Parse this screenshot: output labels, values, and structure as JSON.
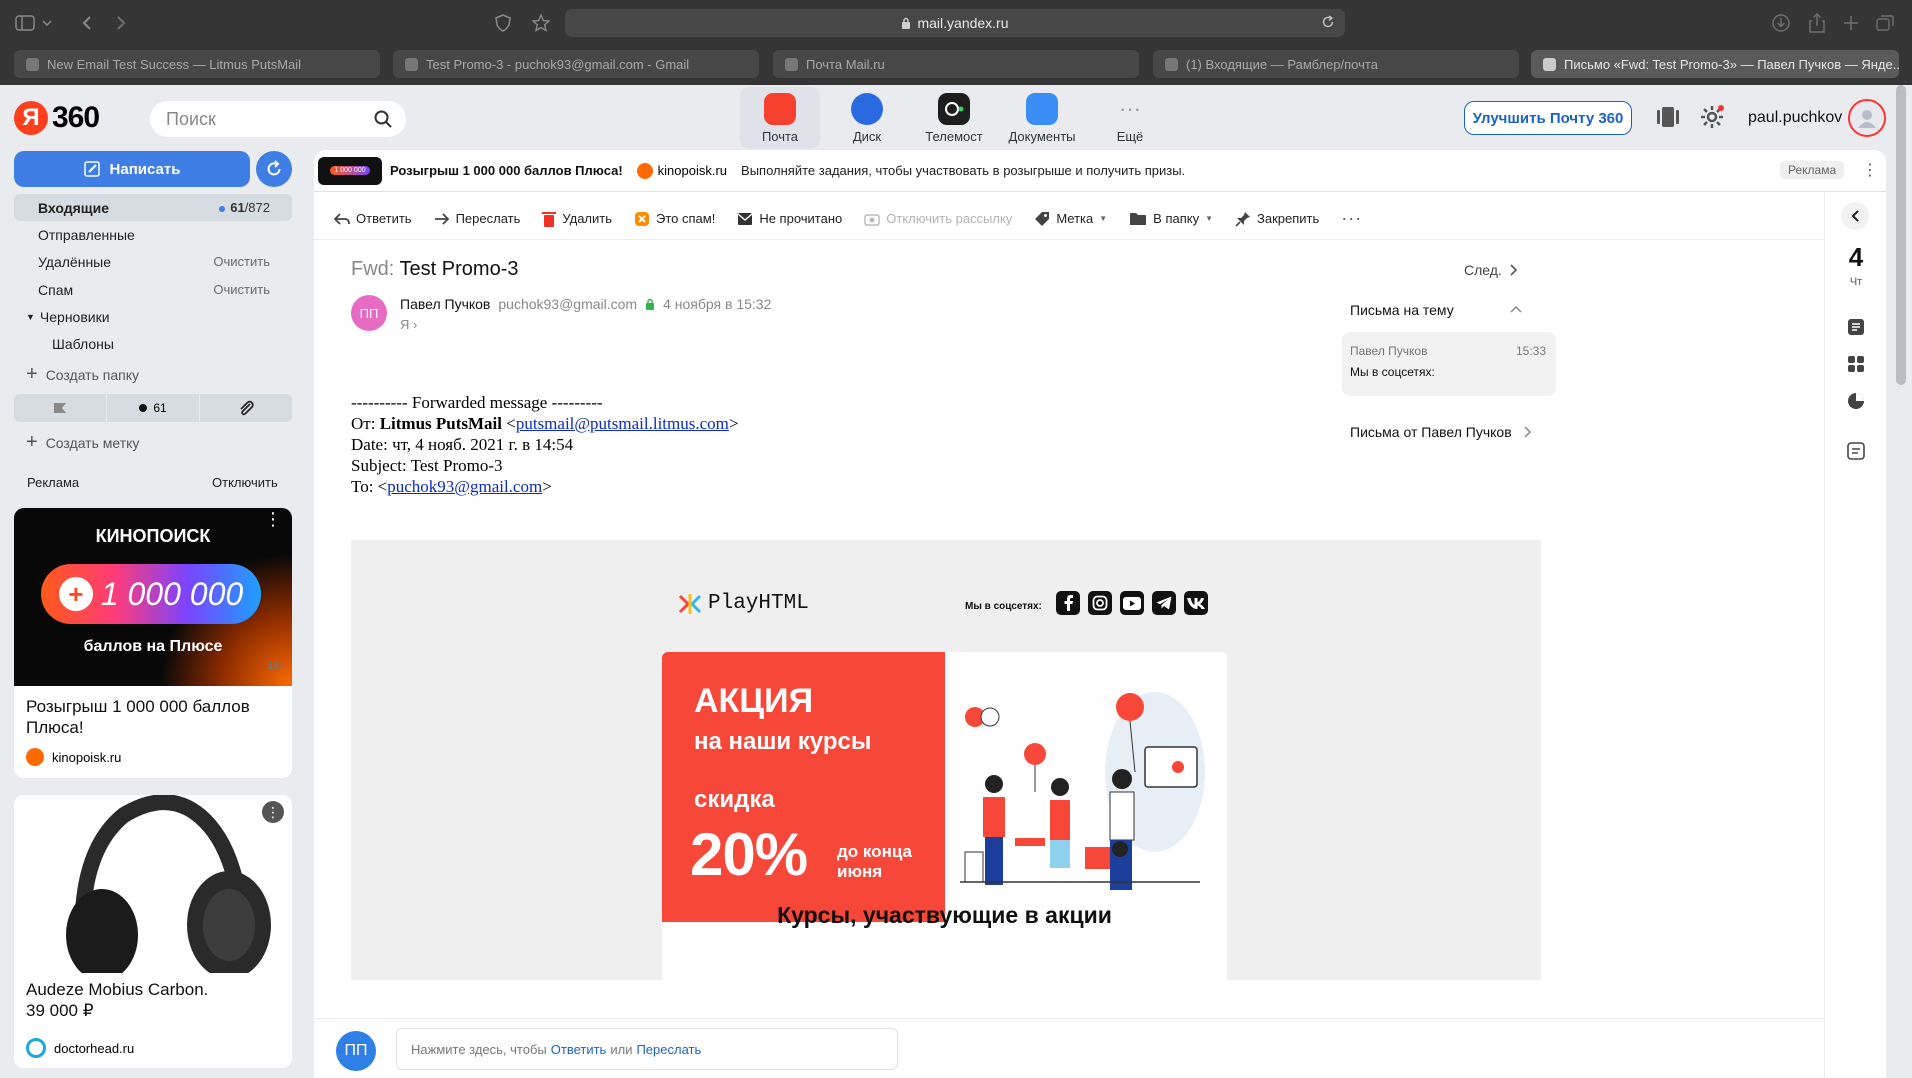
{
  "browser": {
    "url": "mail.yandex.ru",
    "tabs": [
      {
        "label": "New Email Test Success — Litmus PutsMail"
      },
      {
        "label": "Test Promo-3 - puchok93@gmail.com - Gmail"
      },
      {
        "label": "Почта Mail.ru"
      },
      {
        "label": "(1) Входящие — Рамблер/почта"
      },
      {
        "label": "Письмо «Fwd: Test Promo-3» — Павел Пучков — Янде..."
      }
    ]
  },
  "header": {
    "logo_letter": "Я",
    "logo_text": "360",
    "search_placeholder": "Поиск",
    "services": [
      {
        "label": "Почта",
        "color": "#f5412d"
      },
      {
        "label": "Диск",
        "color": "#2a6ae0"
      },
      {
        "label": "Телемост",
        "color": "#1e1e1e"
      },
      {
        "label": "Документы",
        "color": "#3a8df5"
      },
      {
        "label": "Ещё",
        "color": "#9a9a9a"
      }
    ],
    "upgrade_label": "Улучшить Почту 360",
    "username": "paul.puchkov"
  },
  "sidebar": {
    "compose_label": "Написать",
    "folders": [
      {
        "label": "Входящие",
        "count": "61",
        "total": "/872"
      },
      {
        "label": "Отправленные",
        "right": ""
      },
      {
        "label": "Удалённые",
        "right": "Очистить"
      },
      {
        "label": "Спам",
        "right": "Очистить"
      },
      {
        "label": "Черновики",
        "right": ""
      },
      {
        "label": "Шаблоны",
        "right": ""
      }
    ],
    "create_folder": "Создать папку",
    "unread_count": "61",
    "create_label": "Создать метку",
    "ads_title": "Реклама",
    "ads_disable": "Отключить",
    "ad1": {
      "brand": "КИНОПОИСК",
      "amount": "1 000 000",
      "subtitle": "баллов на Плюсе",
      "age": "18+",
      "title": "Розыгрыш 1 000 000 баллов Плюса!",
      "domain": "kinopoisk.ru"
    },
    "ad2": {
      "title": "Audeze Mobius Carbon.",
      "price": "39 000 ₽",
      "domain": "doctorhead.ru"
    }
  },
  "adbar": {
    "thumb_text": "1 000 000",
    "title": "Розыгрыш 1 000 000 баллов Плюса!",
    "domain": "kinopoisk.ru",
    "text": "Выполняйте задания, чтобы участвовать в розыгрыше и получить призы.",
    "badge": "Реклама"
  },
  "toolbar": {
    "reply": "Ответить",
    "forward": "Переслать",
    "delete": "Удалить",
    "spam": "Это спам!",
    "unread": "Не прочитано",
    "unsubscribe": "Отключить рассылку",
    "label": "Метка",
    "folder": "В папку",
    "pin": "Закрепить"
  },
  "message": {
    "subject_prefix": "Fwd:",
    "subject": "Test Promo-3",
    "next": "След.",
    "sender_initials": "ПП",
    "sender_name": "Павел Пучков",
    "sender_email": "puchok93@gmail.com",
    "date": "4 ноября в 15:32",
    "to": "Я",
    "fwd_header": "---------- Forwarded message ---------",
    "from_label": "От:",
    "from_name": "Litmus PutsMail",
    "from_email": "putsmail@putsmail.litmus.com",
    "date_line": "Date: чт, 4 нояб. 2021 г. в 14:54",
    "subject_line": "Subject: Test Promo-3",
    "to_label": "To:",
    "to_email": "puchok93@gmail.com"
  },
  "email_content": {
    "brand": "PlayHTML",
    "social_label": "Мы в соцсетях:",
    "promo_title": "АКЦИЯ",
    "promo_sub": "на наши курсы",
    "discount_label": "скидка",
    "discount": "20%",
    "until": "до конца",
    "until2": "июня",
    "courses_title": "Курсы, участвующие в акции",
    "accent": "#f74738"
  },
  "thread": {
    "title": "Письма на тему",
    "item_sender": "Павел Пучков",
    "item_time": "15:33",
    "item_subject": "Мы в соцсетях:",
    "from_link": "Письма от Павел Пучков"
  },
  "calendar": {
    "day": "4",
    "weekday": "Чт"
  },
  "reply": {
    "initials": "ПП",
    "prompt": "Нажмите здесь, чтобы",
    "reply_link": "Ответить",
    "or": "или",
    "forward_link": "Переслать"
  }
}
